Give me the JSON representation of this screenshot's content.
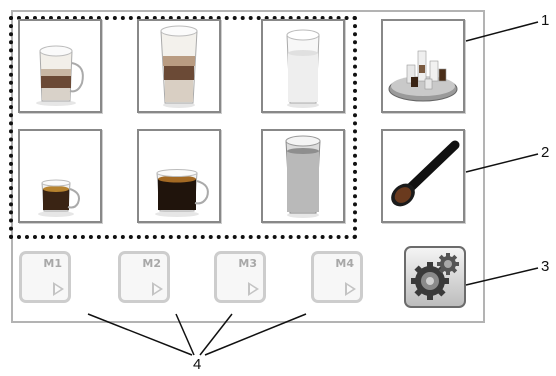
{
  "screen": {
    "drink_buttons": [
      {
        "name": "latte-macchiato-glass-mug"
      },
      {
        "name": "latte-macchiato-tall-glass"
      },
      {
        "name": "milk-foam-glass"
      },
      {
        "name": "espresso-cup"
      },
      {
        "name": "coffee-cup"
      },
      {
        "name": "hot-water-glass"
      }
    ],
    "side_buttons": [
      {
        "name": "tray-of-drinks-button"
      },
      {
        "name": "ground-coffee-spoon-button"
      }
    ],
    "memory_buttons": [
      {
        "label": "M1"
      },
      {
        "label": "M2"
      },
      {
        "label": "M3"
      },
      {
        "label": "M4"
      }
    ],
    "settings_icon": "gear-icon"
  },
  "callouts": {
    "c1": "1",
    "c2": "2",
    "c3": "3",
    "c4": "4"
  }
}
